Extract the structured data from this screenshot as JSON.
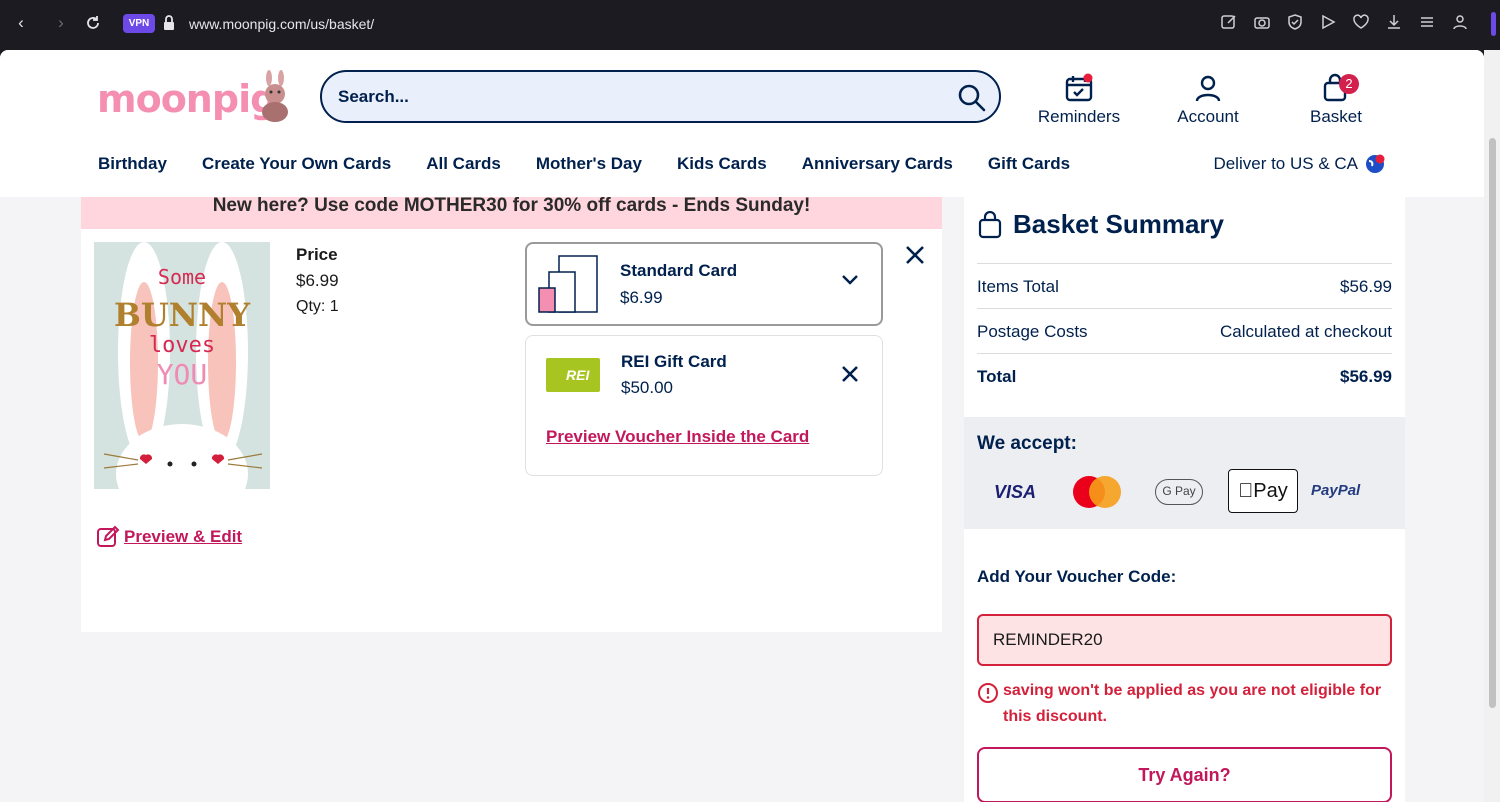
{
  "browser": {
    "url": "www.moonpig.com/us/basket/",
    "vpn_label": "VPN"
  },
  "header": {
    "logo": "moonpig",
    "search_placeholder": "Search...",
    "reminders_label": "Reminders",
    "account_label": "Account",
    "basket_label": "Basket",
    "basket_count": "2"
  },
  "nav": {
    "items": [
      "Birthday",
      "Create Your Own Cards",
      "All Cards",
      "Mother's Day",
      "Kids Cards",
      "Anniversary Cards",
      "Gift Cards"
    ],
    "deliver": "Deliver to US & CA"
  },
  "promo": "New here? Use code MOTHER30 for 30% off cards - Ends Sunday!",
  "item": {
    "card_text": [
      "Some",
      "BUNNY",
      "loves",
      "YOU"
    ],
    "price_label": "Price",
    "price": "$6.99",
    "qty": "Qty: 1",
    "preview_edit": "Preview & Edit",
    "card_option": {
      "title": "Standard Card",
      "price": "$6.99"
    },
    "gift": {
      "title": "REI Gift Card",
      "price": "$50.00",
      "logo": "REI",
      "preview": "Preview Voucher Inside the Card"
    }
  },
  "summary": {
    "title": "Basket Summary",
    "rows": [
      {
        "label": "Items Total",
        "value": "$56.99"
      },
      {
        "label": "Postage Costs",
        "value": "Calculated at checkout"
      },
      {
        "label": "Total",
        "value": "$56.99"
      }
    ],
    "accept_label": "We accept:",
    "payments": {
      "visa": "VISA",
      "gpay": "G Pay",
      "applepay": "Pay",
      "paypal": "PayPal"
    },
    "voucher_label": "Add Your Voucher Code:",
    "voucher_value": "REMINDER20",
    "error": "saving won't be applied as you are not eligible for this discount.",
    "try_again": "Try Again?"
  },
  "colors": {
    "navy": "#00204d",
    "pink": "#c2185b",
    "error": "#d3213b",
    "promo_bg": "#ffd6de"
  }
}
